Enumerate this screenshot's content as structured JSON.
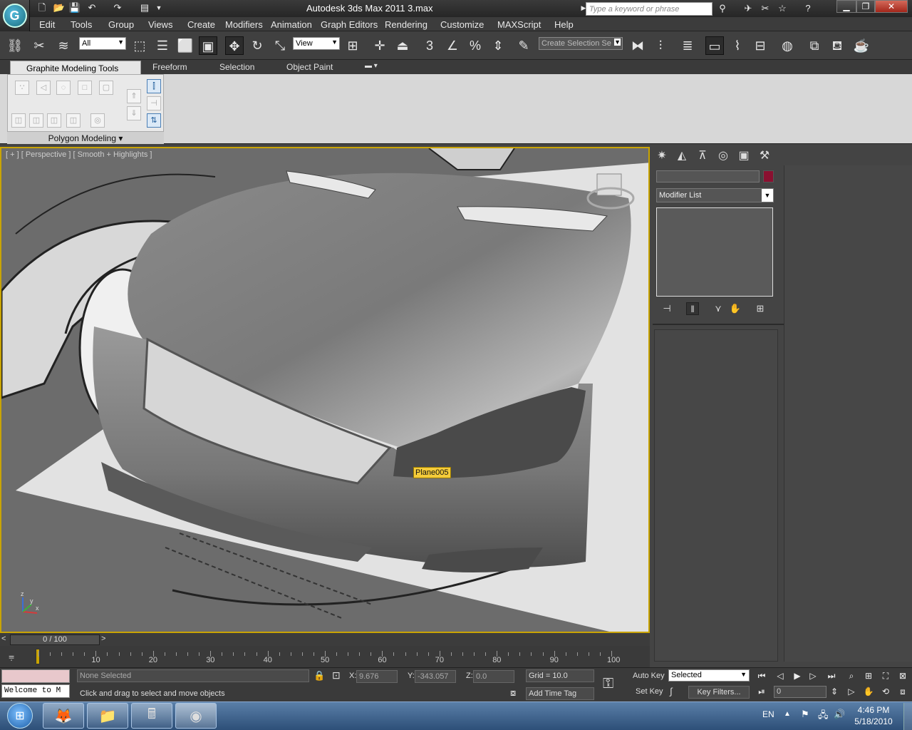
{
  "window": {
    "title": "Autodesk 3ds Max  2011      3.max",
    "search_placeholder": "Type a keyword or phrase",
    "controls": {
      "minimize": "▁",
      "maximize": "❐",
      "close": "✕"
    }
  },
  "menu": {
    "items": [
      "Edit",
      "Tools",
      "Group",
      "Views",
      "Create",
      "Modifiers",
      "Animation",
      "Graph Editors",
      "Rendering",
      "Customize",
      "MAXScript",
      "Help"
    ]
  },
  "toolbar": {
    "filter_value": "All",
    "refcoord_value": "View",
    "named_selection_placeholder": "Create Selection Se",
    "snap_labels": {
      "snap3": "3",
      "percent": "%"
    }
  },
  "ribbon": {
    "tabs": [
      "Graphite Modeling Tools",
      "Freeform",
      "Selection",
      "Object Paint"
    ],
    "panel_label": "Polygon Modeling ▾"
  },
  "viewport": {
    "label": "[ + ] [ Perspective ] [ Smooth + Highlights ]",
    "object_tooltip": "Plane005",
    "axis": {
      "x": "x",
      "y": "y",
      "z": "z"
    }
  },
  "command_panel": {
    "modifier_list_label": "Modifier List"
  },
  "timeline": {
    "slider_text": "0 / 100",
    "prev_label": "<",
    "next_label": ">",
    "ticks": [
      "0",
      "10",
      "20",
      "30",
      "40",
      "50",
      "60",
      "70",
      "80",
      "90",
      "100"
    ]
  },
  "status": {
    "selection_text": "None Selected",
    "prompt_text": "Click and drag to select and move objects",
    "welcome_text": "Welcome to M",
    "x_label": "X:",
    "x_value": "9.676",
    "y_label": "Y:",
    "y_value": "-343.057",
    "z_label": "Z:",
    "z_value": "0.0",
    "grid_text": "Grid = 10.0",
    "add_time_tag": "Add Time Tag",
    "auto_key": "Auto Key",
    "set_key": "Set Key",
    "key_mode_value": "Selected",
    "key_filters": "Key Filters...",
    "frame_value": "0"
  },
  "taskbar": {
    "time": "4:46 PM",
    "date": "5/18/2010",
    "language": "EN"
  }
}
